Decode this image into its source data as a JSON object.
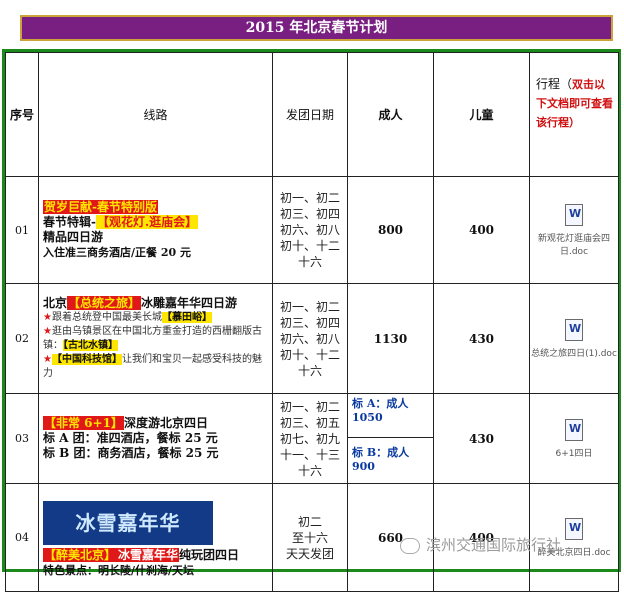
{
  "title": "2015 年北京春节计划",
  "header": {
    "seq": "序号",
    "route": "线路",
    "date": "发团日期",
    "adult": "成人",
    "child": "儿童",
    "itinerary_prefix": "行程（",
    "itinerary_red": "双击以下文档即可查看该行程）"
  },
  "rows": [
    {
      "num": "01",
      "tag": "贺岁巨献-春节特别版",
      "line1_pre": "春节特辑-",
      "line1_hl": "【观花灯.逛庙会】",
      "line2": "精品四日游",
      "line3": "入住准三商务酒店/正餐 20 元",
      "dates": [
        "初一、初二",
        "初三、初四",
        "初六、初八",
        "初十、十二",
        "十六"
      ],
      "adult": "800",
      "child": "400",
      "doc": "新观花灯逛庙会四日.doc"
    },
    {
      "num": "02",
      "title_pre": "北京",
      "title_hl": "【总统之旅】",
      "title_post": "冰雕嘉年华四日游",
      "b1_pre": "跟着总统登中国最美长城",
      "b1_hl": "【慕田峪】",
      "b2_pre": "逛由乌镇景区在中国北方重金打造的西栅翻版古镇：",
      "b2_hl": "【古北水镇】",
      "b3_hl": "【中国科技馆】",
      "b3_post": "让我们和宝贝一起感受科技的魅力",
      "dates": [
        "初一、初二",
        "初三、初四",
        "初六、初八",
        "初十、十二",
        "十六"
      ],
      "adult": "1130",
      "child": "430",
      "doc": "总统之旅四日(1).doc"
    },
    {
      "num": "03",
      "title_hl": "【非常 6+1】",
      "title_post": "深度游北京四日",
      "lineA": "标 A 团：准四酒店，餐标 25 元",
      "lineB": "标 B 团：商务酒店，餐标 25 元",
      "dates": [
        "初一、初二",
        "初三、初五",
        "初七、初九",
        "十一、十三",
        "十六"
      ],
      "adultA": "标 A：成人",
      "adultA_val": "1050",
      "adultB": "标 B：成人",
      "adultB_val": "900",
      "child": "430",
      "doc": "6+1四日"
    },
    {
      "num": "04",
      "banner": "冰雪嘉年华",
      "title_hl": "【醉美北京】",
      "title_hl2": "冰雪嘉年华",
      "title_post": "纯玩团四日",
      "line2": "特色景点：明长陵/什刹海/天坛",
      "dates": [
        "初二",
        "至十六",
        "天天发团"
      ],
      "adult": "660",
      "child": "400",
      "doc": "醉美北京四日.doc"
    }
  ],
  "watermark": "滨州交通国际旅行社"
}
